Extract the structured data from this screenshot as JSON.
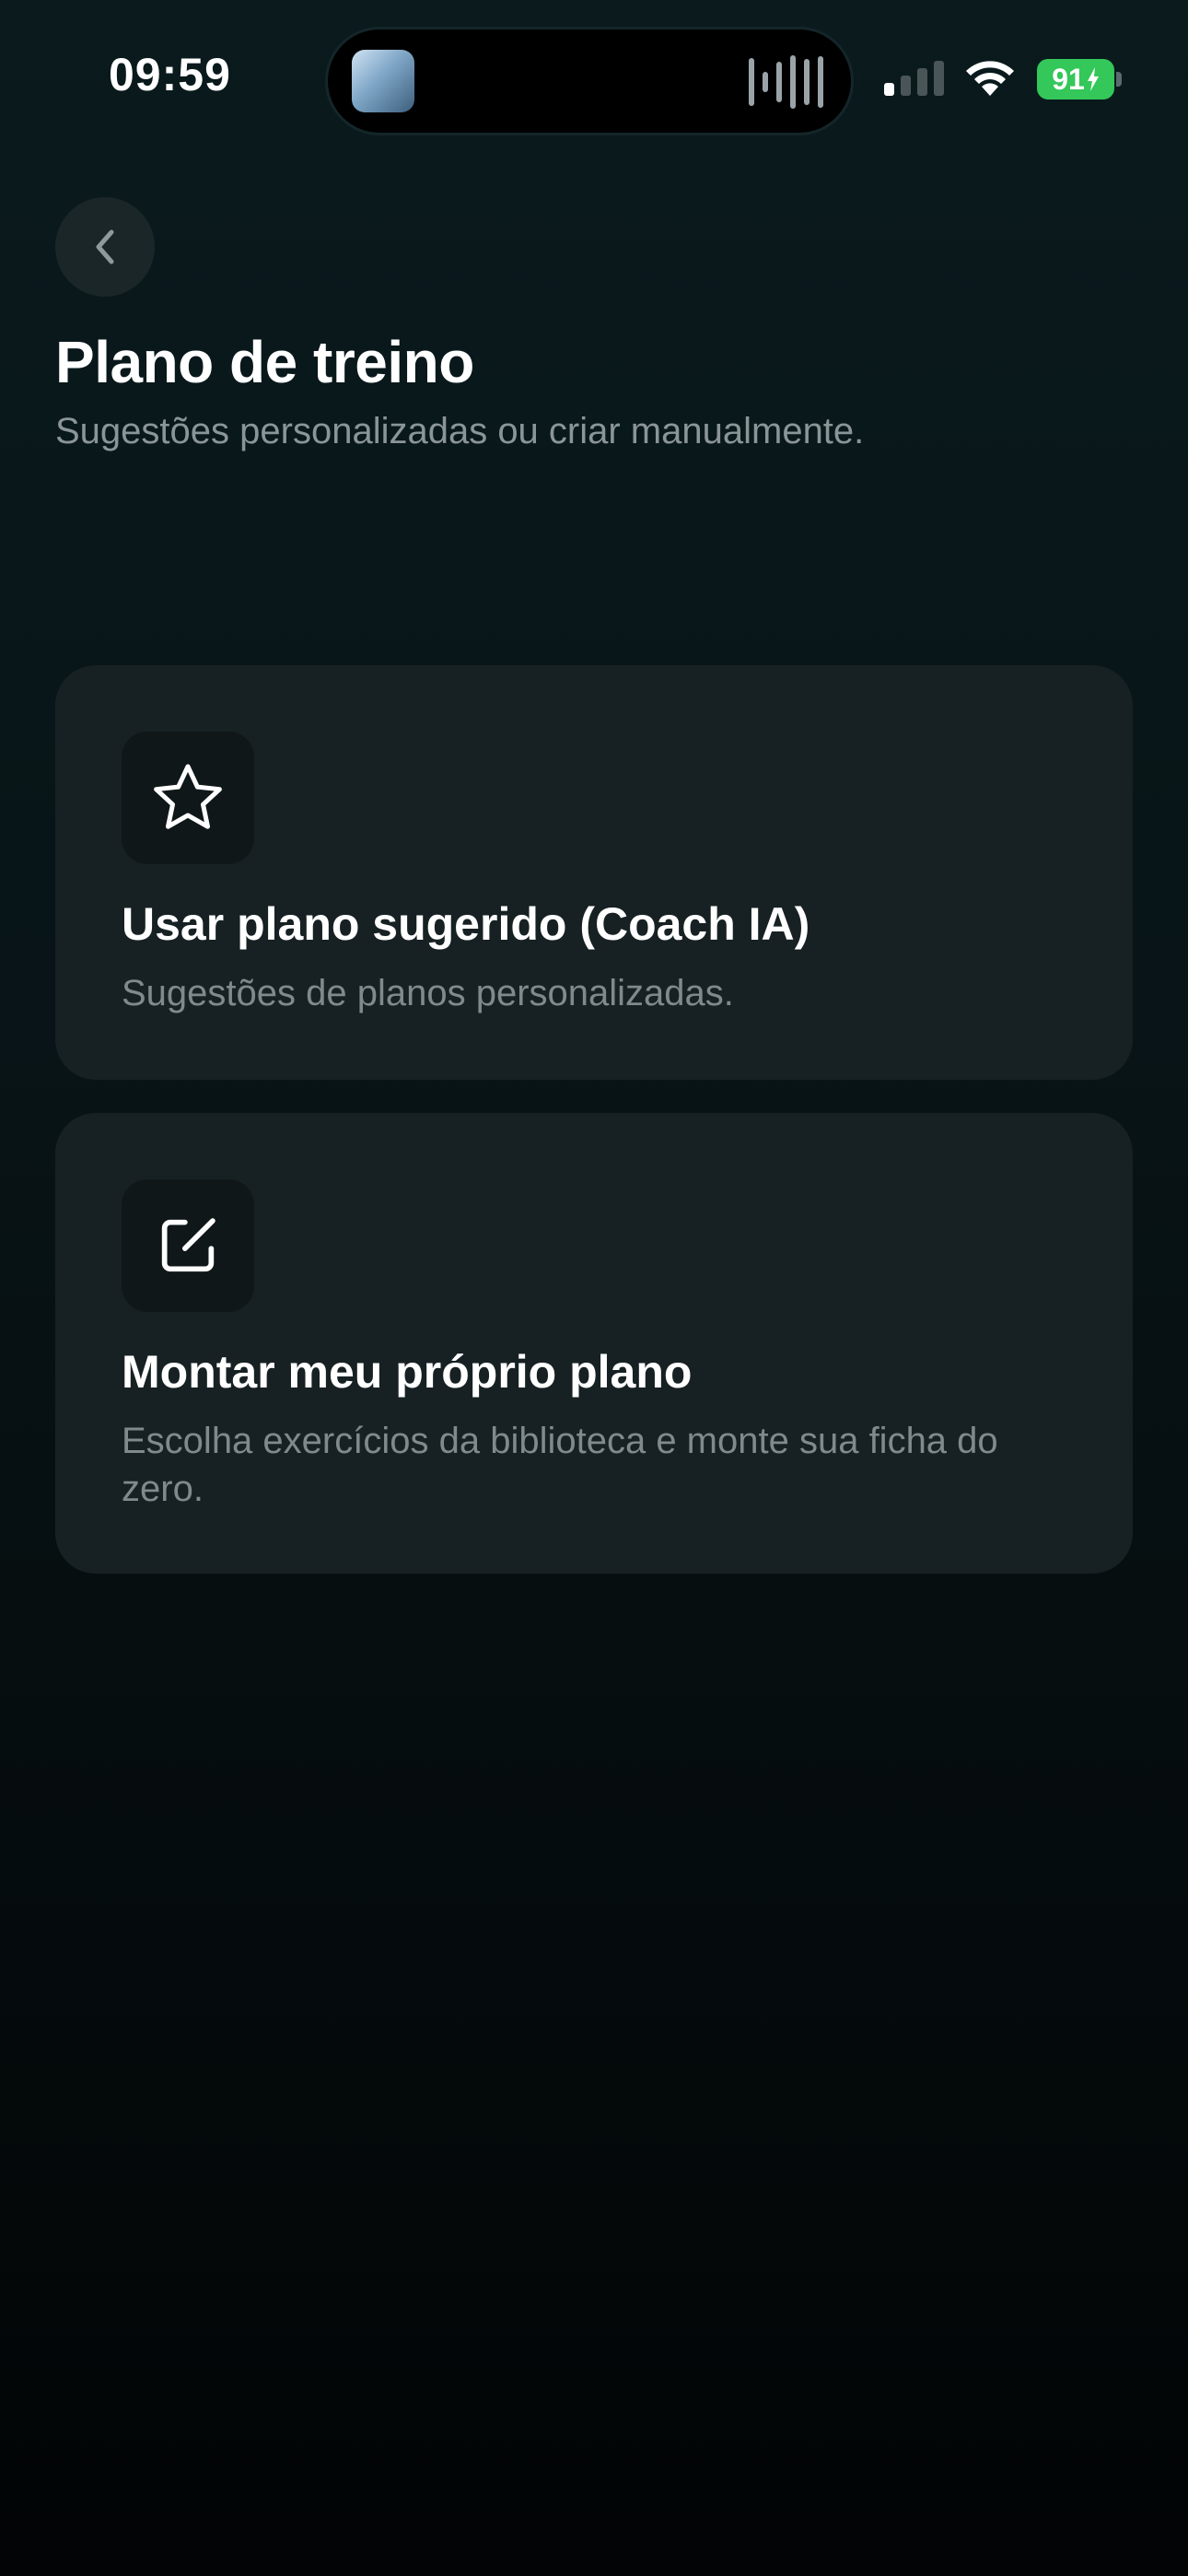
{
  "status_bar": {
    "time": "09:59",
    "battery": "91",
    "battery_color": "#34c759"
  },
  "header": {
    "back_icon": "chevron-left-icon",
    "title": "Plano de treino",
    "subtitle": "Sugestões personalizadas ou criar manualmente."
  },
  "options": [
    {
      "icon": "star-icon",
      "title": "Usar plano sugerido (Coach IA)",
      "description": "Sugestões de planos personalizadas."
    },
    {
      "icon": "edit-icon",
      "title": "Montar meu próprio plano",
      "description": "Escolha exercícios da biblioteca e monte sua ficha do zero."
    }
  ],
  "theme": {
    "background": "#081417",
    "card": "#172123",
    "muted_text": "#8a9597"
  }
}
